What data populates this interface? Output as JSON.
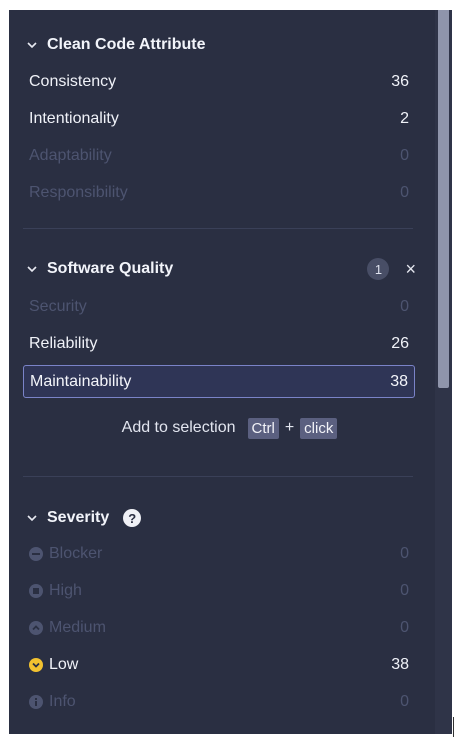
{
  "clean_code": {
    "title": "Clean Code Attribute",
    "items": [
      {
        "label": "Consistency",
        "count": "36"
      },
      {
        "label": "Intentionality",
        "count": "2"
      },
      {
        "label": "Adaptability",
        "count": "0"
      },
      {
        "label": "Responsibility",
        "count": "0"
      }
    ]
  },
  "software_quality": {
    "title": "Software Quality",
    "selected_count": "1",
    "clear_icon": "×",
    "items": [
      {
        "label": "Security",
        "count": "0"
      },
      {
        "label": "Reliability",
        "count": "26"
      },
      {
        "label": "Maintainability",
        "count": "38"
      }
    ],
    "hint": {
      "text": "Add to selection",
      "key": "Ctrl",
      "plus": "+",
      "action": "click"
    }
  },
  "severity": {
    "title": "Severity",
    "help_icon": "?",
    "items": [
      {
        "label": "Blocker",
        "count": "0",
        "icon": "blocker-icon"
      },
      {
        "label": "High",
        "count": "0",
        "icon": "high-icon"
      },
      {
        "label": "Medium",
        "count": "0",
        "icon": "medium-icon"
      },
      {
        "label": "Low",
        "count": "38",
        "icon": "low-icon"
      },
      {
        "label": "Info",
        "count": "0",
        "icon": "info-icon"
      }
    ]
  },
  "colors": {
    "panel_bg": "#2a2f42",
    "active_text": "#f0f2f8",
    "disabled_text": "#4d5470",
    "selected_border": "#7a83c8",
    "low_severity": "#f2c230"
  }
}
